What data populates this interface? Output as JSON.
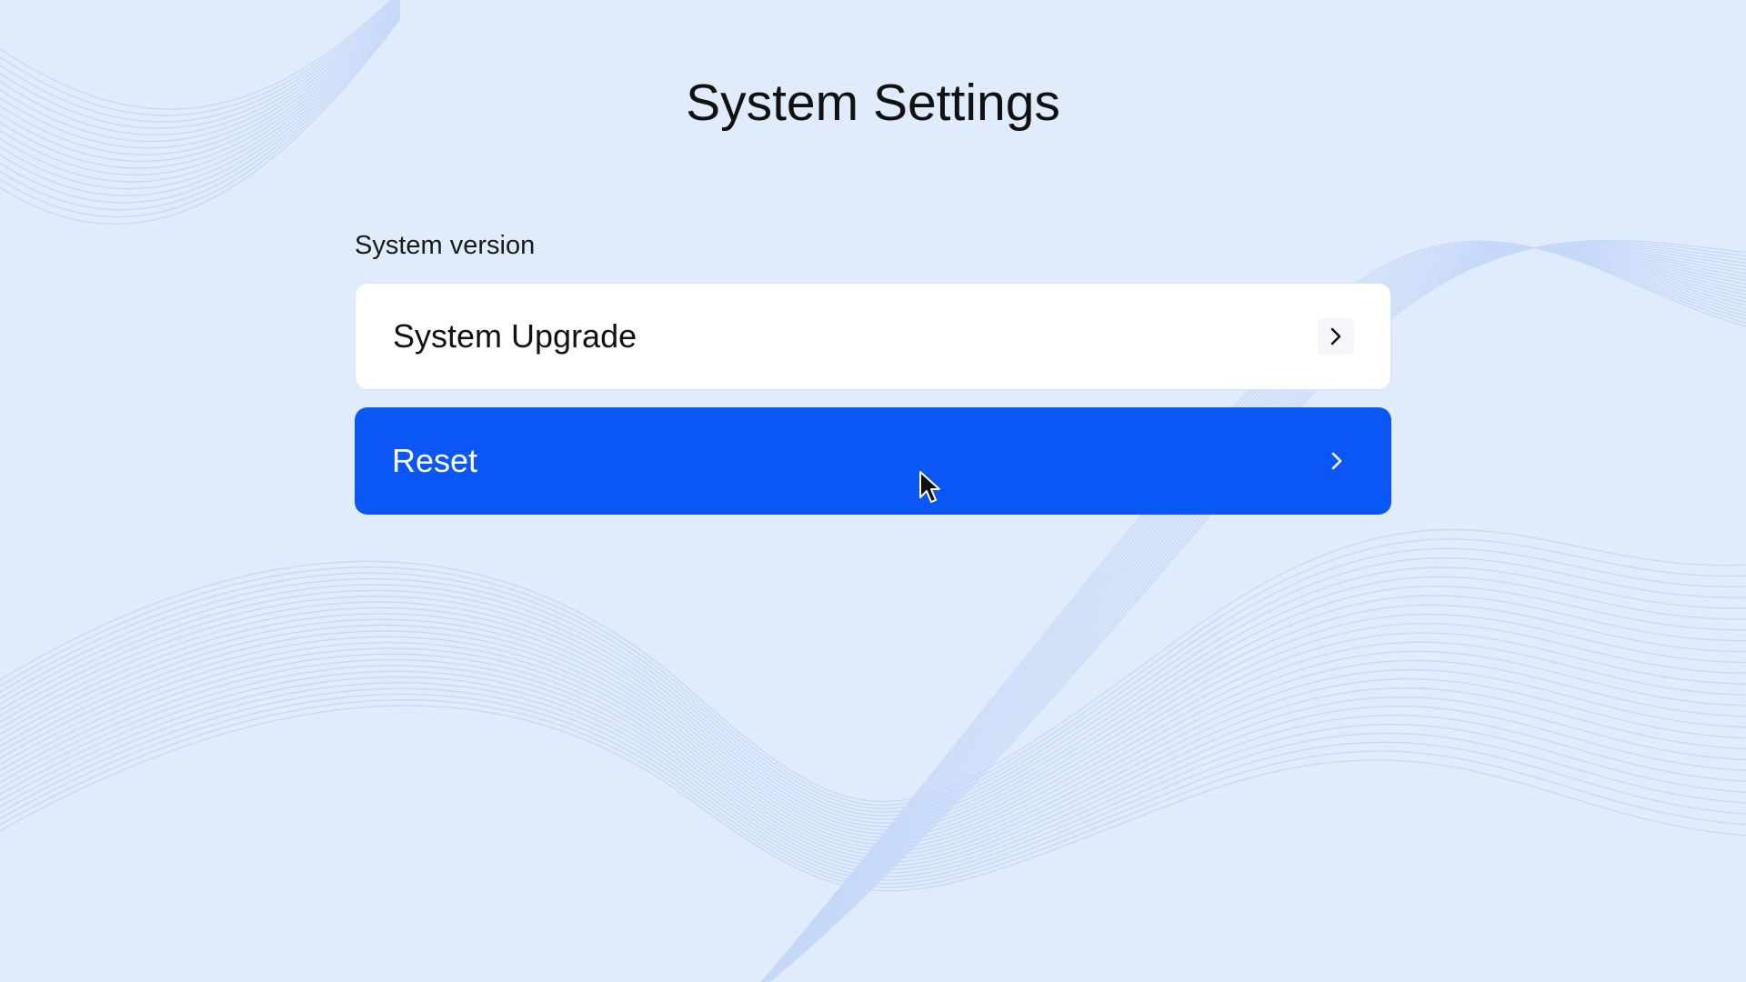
{
  "page": {
    "title": "System Settings"
  },
  "section": {
    "label": "System version"
  },
  "menu": {
    "items": [
      {
        "label": "System Upgrade",
        "icon": "chevron-right-icon",
        "selected": false
      },
      {
        "label": "Reset",
        "icon": "chevron-right-icon",
        "selected": true
      }
    ]
  },
  "colors": {
    "background": "#e0ebfc",
    "accent": "#0b57f5",
    "card": "#ffffff",
    "wave_lines": "#c5d8f8"
  }
}
